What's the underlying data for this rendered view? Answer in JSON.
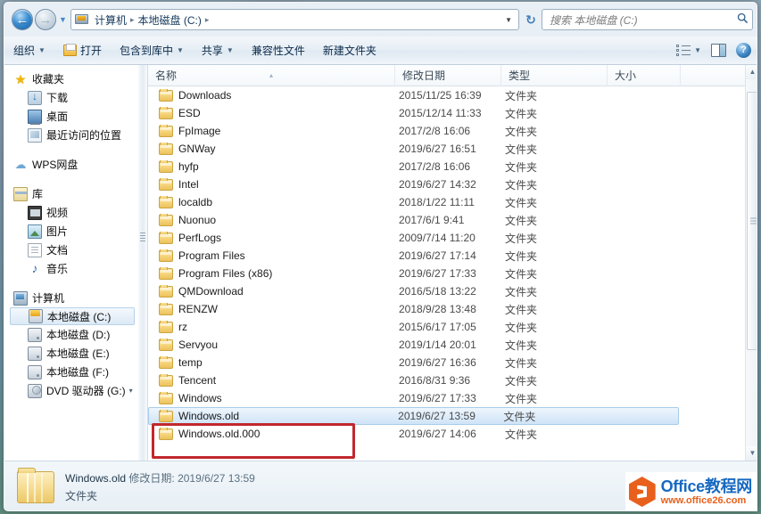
{
  "window": {
    "title": "本地磁盘 (C:)"
  },
  "nav": {
    "back_label": "←",
    "forward_label": "→",
    "history_caret": "▼",
    "refresh_label": "↻",
    "address_caret": "▼",
    "breadcrumbs": [
      "计算机",
      "本地磁盘 (C:)"
    ],
    "separator": "▸",
    "computer_icon": "computer-icon"
  },
  "search": {
    "placeholder": "搜索 本地磁盘 (C:)",
    "value": "",
    "icon": "search-icon"
  },
  "toolbar": {
    "items": [
      {
        "label": "组织",
        "caret": true,
        "icon": null
      },
      {
        "label": "打开",
        "caret": false,
        "icon": "open-folder-icon"
      },
      {
        "label": "包含到库中",
        "caret": true,
        "icon": null
      },
      {
        "label": "共享",
        "caret": true,
        "icon": null
      },
      {
        "label": "兼容性文件",
        "caret": false,
        "icon": null
      },
      {
        "label": "新建文件夹",
        "caret": false,
        "icon": null
      }
    ],
    "caret_glyph": "▼",
    "view_icon": "view-options-icon",
    "view_caret": "▼",
    "pane_icon": "preview-pane-icon",
    "help_icon": "help-icon",
    "help_glyph": "?"
  },
  "sidebar": {
    "groups": [
      {
        "header": {
          "label": "收藏夹",
          "icon": "star-icon"
        },
        "items": [
          {
            "label": "下载",
            "icon": "downloads-icon"
          },
          {
            "label": "桌面",
            "icon": "desktop-icon"
          },
          {
            "label": "最近访问的位置",
            "icon": "recent-places-icon"
          }
        ]
      },
      {
        "header": {
          "label": "WPS网盘",
          "icon": "cloud-icon"
        },
        "items": []
      },
      {
        "header": {
          "label": "库",
          "icon": "library-icon"
        },
        "items": [
          {
            "label": "视频",
            "icon": "video-icon"
          },
          {
            "label": "图片",
            "icon": "pictures-icon"
          },
          {
            "label": "文档",
            "icon": "documents-icon"
          },
          {
            "label": "音乐",
            "icon": "music-icon"
          }
        ]
      },
      {
        "header": {
          "label": "计算机",
          "icon": "computer-icon"
        },
        "items": [
          {
            "label": "本地磁盘 (C:)",
            "icon": "system-drive-icon",
            "selected": true
          },
          {
            "label": "本地磁盘 (D:)",
            "icon": "drive-icon"
          },
          {
            "label": "本地磁盘 (E:)",
            "icon": "drive-icon"
          },
          {
            "label": "本地磁盘 (F:)",
            "icon": "drive-icon"
          },
          {
            "label": "DVD 驱动器 (G:)",
            "icon": "dvd-drive-icon",
            "expander": "▾"
          }
        ]
      }
    ]
  },
  "file_list": {
    "columns": [
      {
        "key": "name",
        "label": "名称",
        "sorted": true,
        "sort_glyph": "▴"
      },
      {
        "key": "date",
        "label": "修改日期"
      },
      {
        "key": "type",
        "label": "类型"
      },
      {
        "key": "size",
        "label": "大小"
      }
    ],
    "rows": [
      {
        "name": "Downloads",
        "date": "2015/11/25 16:39",
        "type": "文件夹",
        "size": ""
      },
      {
        "name": "ESD",
        "date": "2015/12/14 11:33",
        "type": "文件夹",
        "size": ""
      },
      {
        "name": "FpImage",
        "date": "2017/2/8 16:06",
        "type": "文件夹",
        "size": ""
      },
      {
        "name": "GNWay",
        "date": "2019/6/27 16:51",
        "type": "文件夹",
        "size": ""
      },
      {
        "name": "hyfp",
        "date": "2017/2/8 16:06",
        "type": "文件夹",
        "size": ""
      },
      {
        "name": "Intel",
        "date": "2019/6/27 14:32",
        "type": "文件夹",
        "size": ""
      },
      {
        "name": "localdb",
        "date": "2018/1/22 11:11",
        "type": "文件夹",
        "size": ""
      },
      {
        "name": "Nuonuo",
        "date": "2017/6/1 9:41",
        "type": "文件夹",
        "size": ""
      },
      {
        "name": "PerfLogs",
        "date": "2009/7/14 11:20",
        "type": "文件夹",
        "size": ""
      },
      {
        "name": "Program Files",
        "date": "2019/6/27 17:14",
        "type": "文件夹",
        "size": ""
      },
      {
        "name": "Program Files (x86)",
        "date": "2019/6/27 17:33",
        "type": "文件夹",
        "size": ""
      },
      {
        "name": "QMDownload",
        "date": "2016/5/18 13:22",
        "type": "文件夹",
        "size": ""
      },
      {
        "name": "RENZW",
        "date": "2018/9/28 13:48",
        "type": "文件夹",
        "size": ""
      },
      {
        "name": "rz",
        "date": "2015/6/17 17:05",
        "type": "文件夹",
        "size": ""
      },
      {
        "name": "Servyou",
        "date": "2019/1/14 20:01",
        "type": "文件夹",
        "size": ""
      },
      {
        "name": "temp",
        "date": "2019/6/27 16:36",
        "type": "文件夹",
        "size": ""
      },
      {
        "name": "Tencent",
        "date": "2016/8/31 9:36",
        "type": "文件夹",
        "size": ""
      },
      {
        "name": "Windows",
        "date": "2019/6/27 17:33",
        "type": "文件夹",
        "size": ""
      },
      {
        "name": "Windows.old",
        "date": "2019/6/27 13:59",
        "type": "文件夹",
        "size": "",
        "selected": true
      },
      {
        "name": "Windows.old.000",
        "date": "2019/6/27 14:06",
        "type": "文件夹",
        "size": ""
      }
    ]
  },
  "scrollbar": {
    "up_glyph": "▲",
    "down_glyph": "▼"
  },
  "annotation": {
    "color": "#c1272d",
    "targets": [
      "Windows.old",
      "Windows.old.000"
    ]
  },
  "status_bar": {
    "name": "Windows.old",
    "date_label": "修改日期:",
    "date_value": "2019/6/27 13:59",
    "type": "文件夹",
    "icon": "folder-icon"
  },
  "watermark": {
    "brand": "Office",
    "brand_cn": "教程网",
    "url": "www.office26.com",
    "logo_color": "#e8601c",
    "text_color": "#1669c1"
  }
}
